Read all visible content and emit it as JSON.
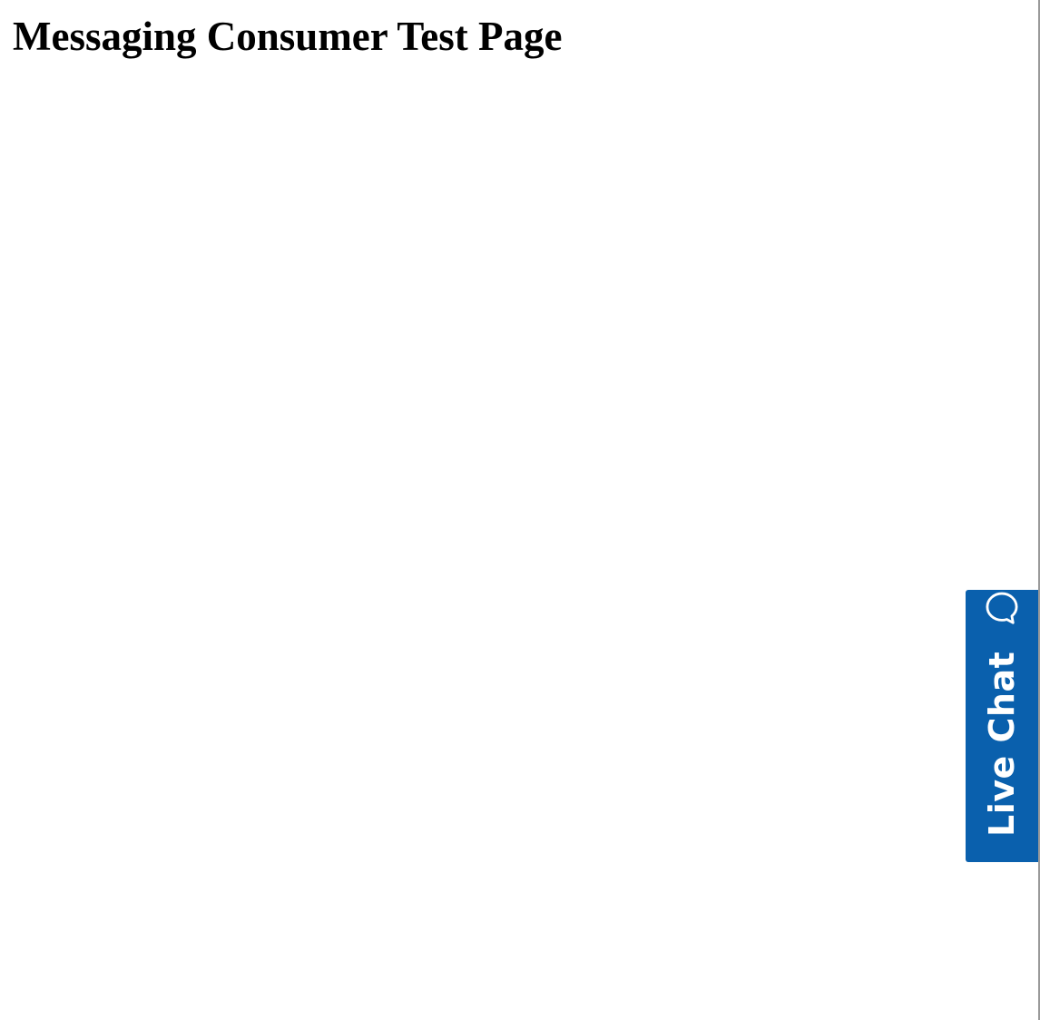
{
  "page": {
    "title": "Messaging Consumer Test Page"
  },
  "live_chat": {
    "label": "Live Chat",
    "icon": "chat-bubble-icon",
    "background_color": "#0a60ad",
    "text_color": "#ffffff"
  }
}
